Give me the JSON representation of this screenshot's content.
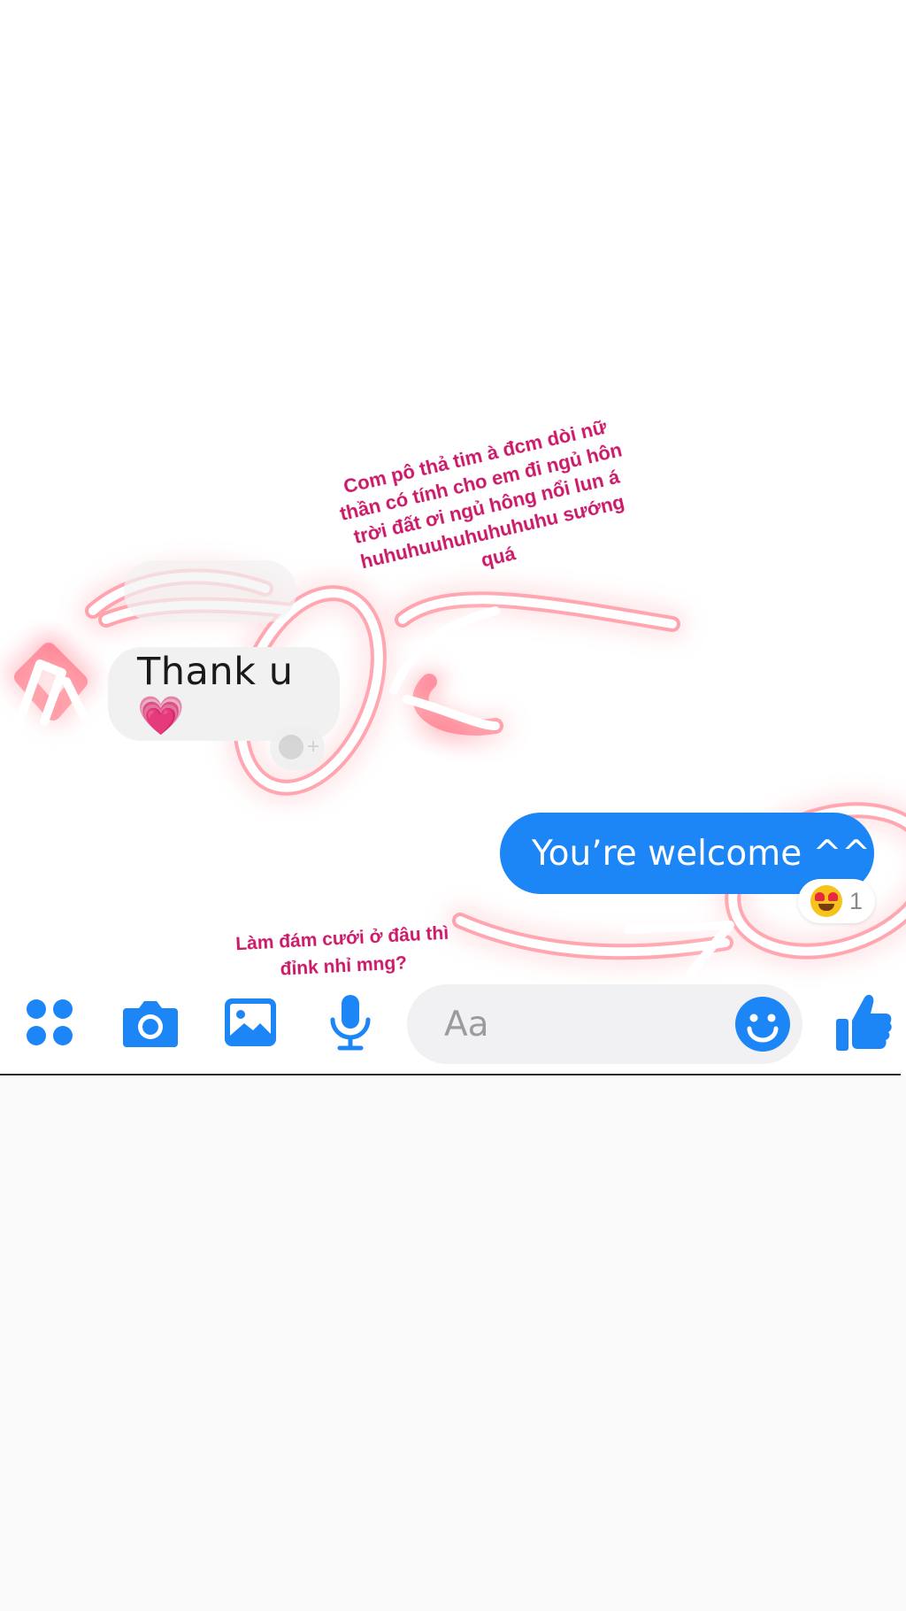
{
  "story_captions": {
    "top": "Com pô thả tim à đcm dòi nữ thần có tính cho em đi ngủ hôn trời đất ơi ngủ hông nổi lun á huhuhuuhuhuhuhuhu sướng quá",
    "bottom": "Làm đám cưới ở đâu thì đỉnk nhỉ mng?"
  },
  "conversation": {
    "incoming_message": "Thank u💗",
    "outgoing_message": "You’re welcome ^^",
    "reaction": {
      "emoji": "heart-eyes",
      "count": "1"
    }
  },
  "composer": {
    "placeholder": "Aa",
    "icons": [
      "more-apps-icon",
      "camera-icon",
      "gallery-icon",
      "microphone-icon",
      "emoji-icon",
      "thumbs-up-icon"
    ]
  },
  "colors": {
    "messenger_blue": "#1d86f7",
    "caption_pink": "#cc1a6a",
    "glow_red": "#ff3b5c"
  }
}
